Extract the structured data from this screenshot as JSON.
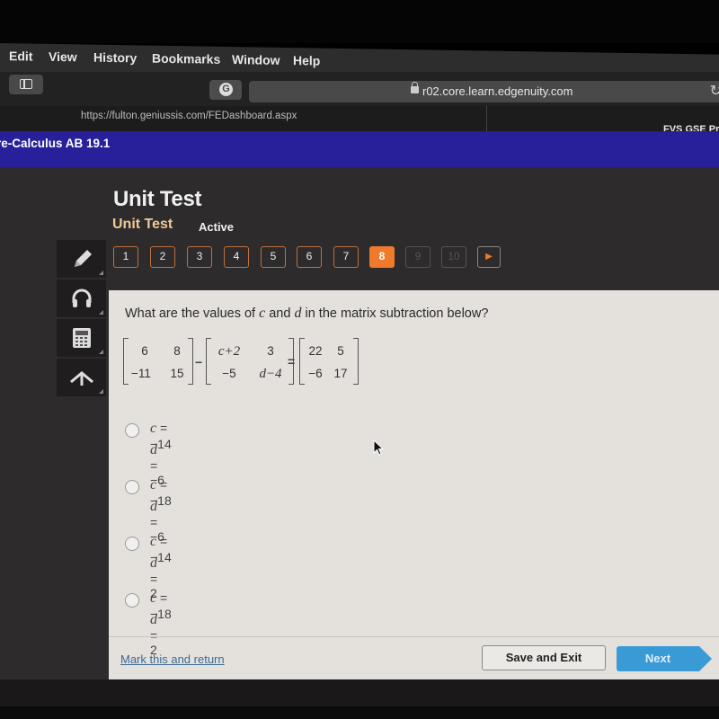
{
  "menubar": {
    "items": [
      "Edit",
      "View",
      "History",
      "Bookmarks",
      "Window",
      "Help"
    ]
  },
  "browser": {
    "address_url": "r02.core.learn.edgenuity.com",
    "tabs": [
      {
        "label": "https://fulton.geniussis.com/FEDashboard.aspx"
      },
      {
        "label": "FVS GSE Pre"
      }
    ]
  },
  "course": {
    "title": "re-Calculus AB 19.1"
  },
  "test": {
    "title": "Unit Test",
    "subtitle": "Unit Test",
    "status": "Active",
    "questions": [
      {
        "label": "1",
        "state": "answered"
      },
      {
        "label": "2",
        "state": "answered"
      },
      {
        "label": "3",
        "state": "answered"
      },
      {
        "label": "4",
        "state": "answered"
      },
      {
        "label": "5",
        "state": "answered"
      },
      {
        "label": "6",
        "state": "answered"
      },
      {
        "label": "7",
        "state": "answered"
      },
      {
        "label": "8",
        "state": "current"
      },
      {
        "label": "9",
        "state": "disabled"
      },
      {
        "label": "10",
        "state": "disabled"
      }
    ],
    "next_arrow": "▶",
    "accent_color": "#f07a2c"
  },
  "tools": [
    "pencil-icon",
    "headphones-icon",
    "calculator-icon",
    "collapse-icon"
  ],
  "question": {
    "prefix": "What are the values of ",
    "var_c": "c",
    "mid": " and ",
    "var_d": "d",
    "suffix": " in the matrix subtraction below?",
    "matrix_a": [
      [
        "6",
        "8"
      ],
      [
        "−11",
        "15"
      ]
    ],
    "matrix_b": [
      [
        "c+2",
        "3"
      ],
      [
        "−5",
        "d−4"
      ]
    ],
    "matrix_c": [
      [
        "22",
        "5"
      ],
      [
        "−6",
        "17"
      ]
    ],
    "op_minus": "−",
    "op_equals": "="
  },
  "choices": [
    {
      "c_label": "c",
      "c_value": " = −14",
      "d_label": "d",
      "d_value": " = −6"
    },
    {
      "c_label": "c",
      "c_value": " = −18",
      "d_label": "d",
      "d_value": " = −6"
    },
    {
      "c_label": "c",
      "c_value": " = −14",
      "d_label": "d",
      "d_value": " = 2"
    },
    {
      "c_label": "c",
      "c_value": " = −18",
      "d_label": "d",
      "d_value": " = 2"
    }
  ],
  "footer": {
    "mark_label": "Mark this and return",
    "save_label": "Save and Exit",
    "next_label": "Next"
  }
}
